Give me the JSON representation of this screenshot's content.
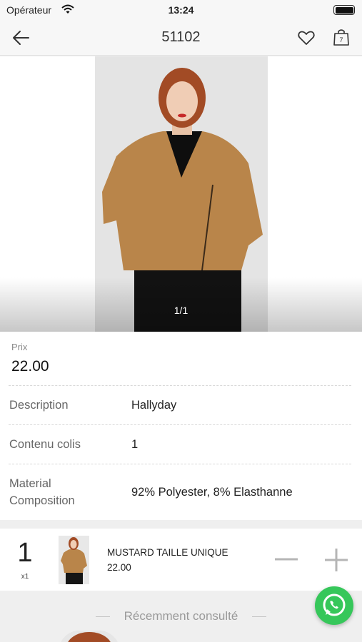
{
  "status": {
    "carrier": "Opérateur",
    "time": "13:24"
  },
  "nav": {
    "title": "51102"
  },
  "gallery": {
    "counter": "1/1"
  },
  "product": {
    "price_label": "Prix",
    "price": "22.00",
    "rows": [
      {
        "label": "Description",
        "value": "Hallyday"
      },
      {
        "label": "Contenu colis",
        "value": "1"
      },
      {
        "label": "Material Composition",
        "value": "92% Polyester, 8% Elasthanne"
      }
    ]
  },
  "cart": {
    "quantity": "1",
    "quantity_unit": "x1",
    "variant_name": "MUSTARD TAILLE UNIQUE",
    "variant_price": "22.00"
  },
  "recent": {
    "heading": "Récemment consulté"
  },
  "colors": {
    "whatsapp": "#36c75a",
    "jacket": "#b9854a"
  }
}
